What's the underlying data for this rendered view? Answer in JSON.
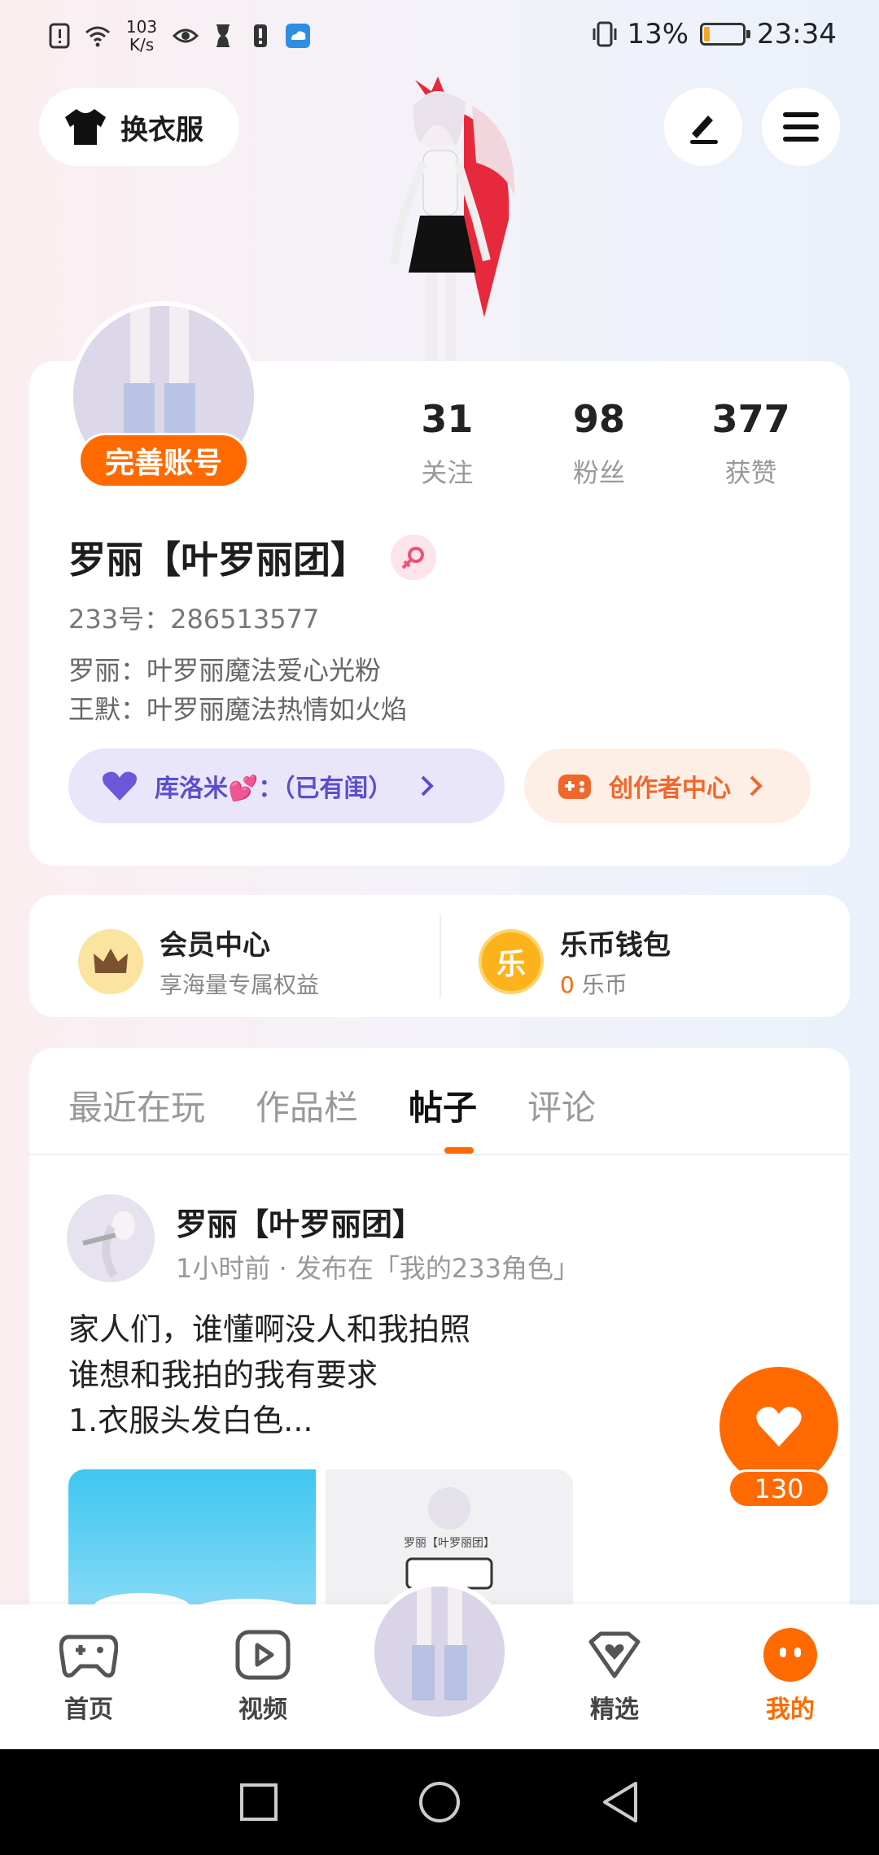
{
  "status_bar": {
    "net_speed_value": "103",
    "net_speed_unit": "K/s",
    "battery_percent": "13%",
    "battery_level": 0.13,
    "time": "23:34"
  },
  "header": {
    "outfit_button": "换衣服"
  },
  "profile": {
    "complete_account": "完善账号",
    "stats": [
      {
        "value": "31",
        "label": "关注"
      },
      {
        "value": "98",
        "label": "粉丝"
      },
      {
        "value": "377",
        "label": "获赞"
      }
    ],
    "username": "罗丽【叶罗丽团】",
    "uid": "233号：286513577",
    "bio_lines": [
      "罗丽：叶罗丽魔法爱心光粉",
      "王默：叶罗丽魔法热情如火焰"
    ],
    "relation_pill": "库洛米💕：（已有闺）",
    "creator_center": "创作者中心"
  },
  "member": {
    "vip_title": "会员中心",
    "vip_sub": "享海量专属权益",
    "wallet_title": "乐币钱包",
    "wallet_amount": "0",
    "wallet_unit": "乐币",
    "wallet_icon_char": "乐"
  },
  "tabs": [
    "最近在玩",
    "作品栏",
    "帖子",
    "评论"
  ],
  "active_tab": "帖子",
  "post": {
    "author": "罗丽【叶罗丽团】",
    "meta": "1小时前 · 发布在「我的233角色」",
    "text_lines": [
      "家人们，谁懂啊没人和我拍照",
      "谁想和我拍的我有要求",
      "1.衣服头发白色..."
    ],
    "image2_caption": "罗丽【叶罗丽团】"
  },
  "like": {
    "count": "130"
  },
  "bottom_nav": {
    "items": [
      {
        "label": "首页"
      },
      {
        "label": "视频"
      },
      {
        "label": "精选"
      },
      {
        "label": "我的"
      }
    ]
  },
  "colors": {
    "accent": "#ff6a00",
    "purple": "#5a4fc9"
  }
}
